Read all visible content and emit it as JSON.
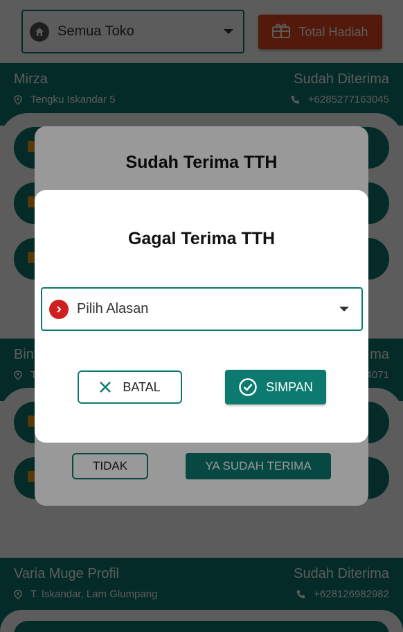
{
  "filter": {
    "store_select_value": "Semua Toko",
    "total_button_label": "Total Hadiah"
  },
  "shops": [
    {
      "name": "Mirza",
      "status": "Sudah Diterima",
      "address": "Tengku Iskandar 5",
      "phone": "+6285277163045"
    },
    {
      "name": "Bint",
      "status": "ma",
      "address": "T",
      "phone": "4071"
    },
    {
      "name": "Varia Muge Profil",
      "status": "Sudah Diterima",
      "address": "T. Iskandar, Lam Glumpang",
      "phone": "+628126982982"
    }
  ],
  "confirm_dialog": {
    "title": "Sudah Terima TTH",
    "no_label": "TIDAK",
    "yes_label": "YA SUDAH TERIMA"
  },
  "fail_dialog": {
    "title": "Gagal Terima TTH",
    "reason_placeholder": "Pilih Alasan",
    "cancel_label": "BATAL",
    "save_label": "SIMPAN"
  },
  "colors": {
    "primary": "#0c7a6f",
    "accent": "#e8461e",
    "danger": "#d01f1f"
  },
  "icons": [
    "home-icon",
    "gift-box-icon",
    "location-pin-icon",
    "phone-icon",
    "chevron-right-icon",
    "close-icon",
    "check-circle-icon",
    "dropdown-caret-icon"
  ]
}
